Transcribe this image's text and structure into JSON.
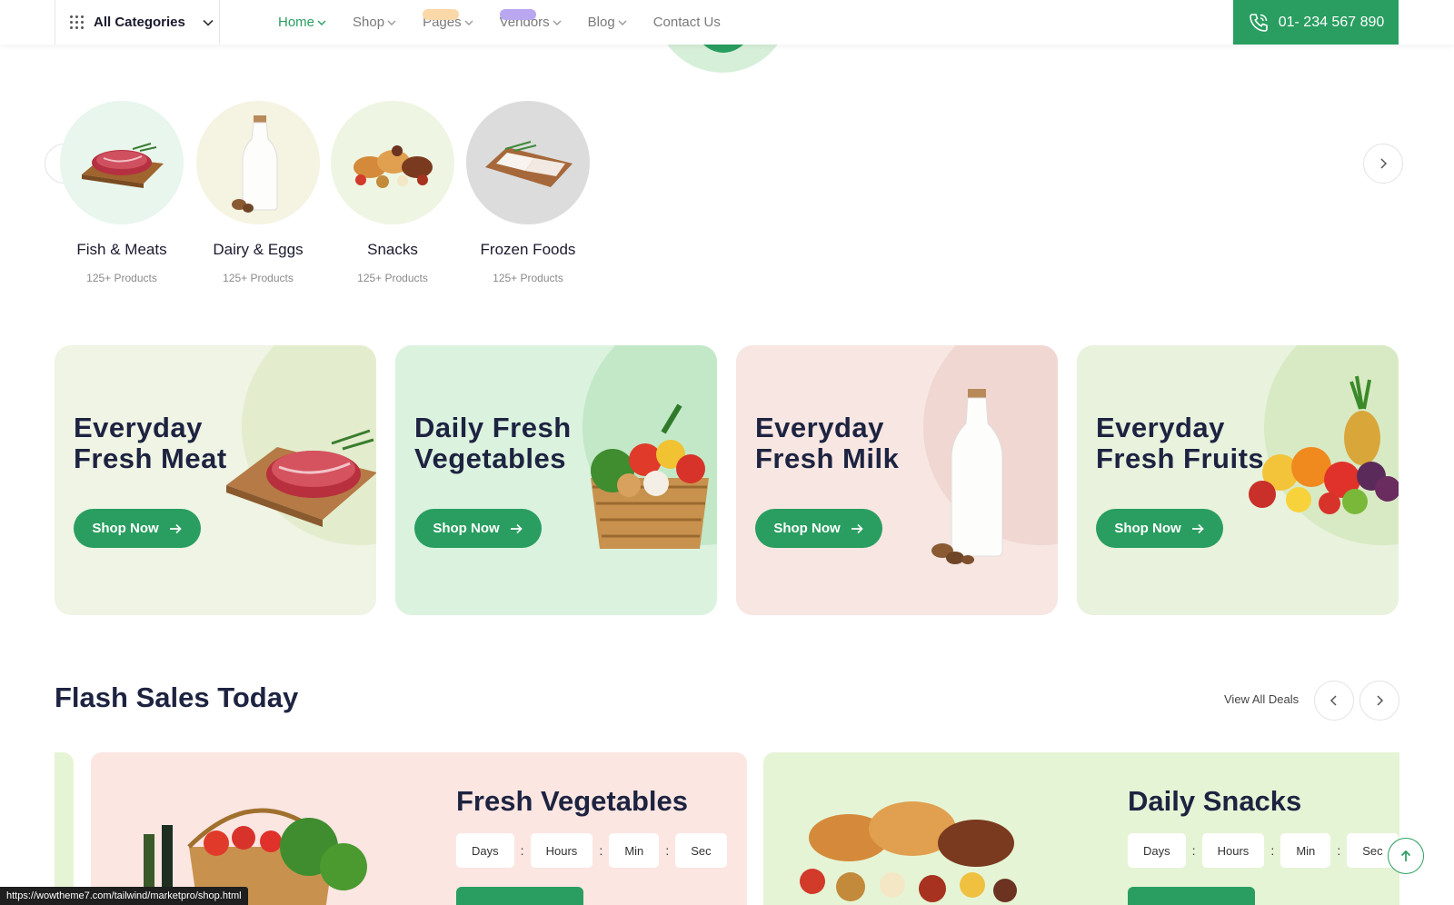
{
  "nav": {
    "all_categories": "All  Categories",
    "links": [
      "Home",
      "Shop",
      "Pages",
      "Vendors",
      "Blog",
      "Contact Us"
    ],
    "phone": "01- 234 567 890",
    "accent": "#299e60"
  },
  "categories": [
    {
      "name": "Fish & Meats",
      "count": "125+ Products",
      "bg": "#e8f6ee"
    },
    {
      "name": "Dairy & Eggs",
      "count": "125+ Products",
      "bg": "#f5f3e2"
    },
    {
      "name": "Snacks",
      "count": "125+ Products",
      "bg": "#eef5e2"
    },
    {
      "name": "Frozen Foods",
      "count": "125+ Products",
      "bg": "#dcdcdc"
    }
  ],
  "promos": [
    {
      "title": "Everyday Fresh Meat",
      "button": "Shop Now",
      "bg": "#eff4e4",
      "blob": "#e3edce"
    },
    {
      "title": "Daily Fresh Vegetables",
      "button": "Shop Now",
      "bg": "#dbf2df",
      "blob": "#c3e8c8"
    },
    {
      "title": "Everyday Fresh Milk",
      "button": "Shop Now",
      "bg": "#f7e6e2",
      "blob": "#f0d7d1"
    },
    {
      "title": "Everyday Fresh Fruits",
      "button": "Shop Now",
      "bg": "#e8f2dd",
      "blob": "#d8eac4"
    }
  ],
  "flash": {
    "title": "Flash Sales Today",
    "view_all": "View All Deals",
    "cards": [
      {
        "title": "Fresh Vegetables",
        "bg": "#fbe6e2",
        "timer": [
          "Days",
          "Hours",
          "Min",
          "Sec"
        ]
      },
      {
        "title": "Daily Snacks",
        "bg": "#e6f4d6",
        "timer": [
          "Days",
          "Hours",
          "Min",
          "Sec"
        ]
      }
    ]
  },
  "status_url": "https://wowtheme7.com/tailwind/marketpro/shop.html"
}
